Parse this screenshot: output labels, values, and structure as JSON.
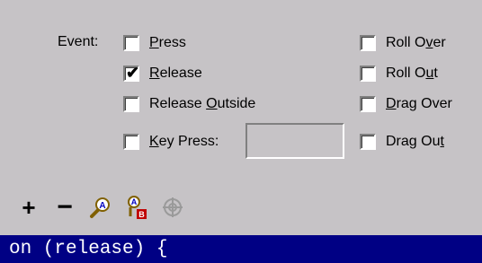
{
  "event": {
    "label": "Event:"
  },
  "checkboxes": {
    "press": {
      "pre": "",
      "ul": "P",
      "post": "ress",
      "checked": false
    },
    "release": {
      "pre": "",
      "ul": "R",
      "post": "elease",
      "checked": true
    },
    "release_outside": {
      "pre": "Release ",
      "ul": "O",
      "post": "utside",
      "checked": false
    },
    "key_press": {
      "pre": "",
      "ul": "K",
      "post": "ey Press:",
      "checked": false
    },
    "roll_over": {
      "pre": "Roll O",
      "ul": "v",
      "post": "er",
      "checked": false
    },
    "roll_out": {
      "pre": "Roll O",
      "ul": "u",
      "post": "t",
      "checked": false
    },
    "drag_over": {
      "pre": "",
      "ul": "D",
      "post": "rag Over",
      "checked": false
    },
    "drag_out": {
      "pre": "Drag Ou",
      "ul": "t",
      "post": "",
      "checked": false
    }
  },
  "key_press_value": "",
  "toolbar": {
    "add": "+",
    "remove": "−",
    "icons": [
      "find-icon",
      "replace-icon",
      "target-icon"
    ]
  },
  "code": {
    "line": "on (release) {"
  },
  "colors": {
    "background": "#c6c3c6",
    "code_bar": "#000084"
  }
}
